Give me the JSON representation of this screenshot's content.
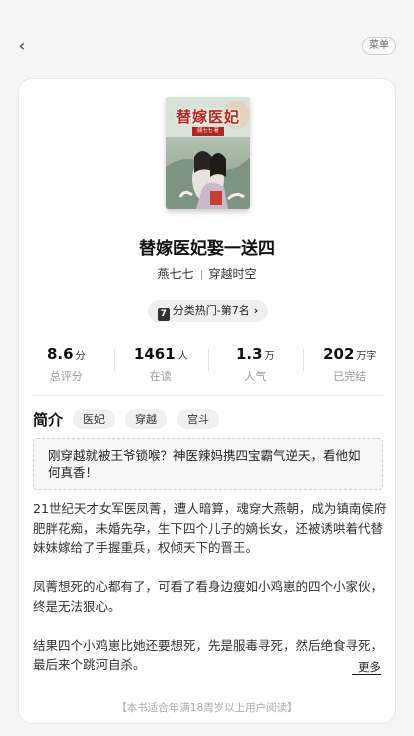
{
  "menu_label": "菜单",
  "cover": {
    "title_art": "替嫁医妃",
    "subtitle_art": "顾七七·著"
  },
  "book": {
    "title": "替嫁医妃娶一送四",
    "author": "燕七七",
    "category": "穿越时空"
  },
  "rank": {
    "badge": "7",
    "text": "分类热门-第7名"
  },
  "stats": [
    {
      "value": "8.6",
      "unit": "分",
      "label": "总评分"
    },
    {
      "value": "1461",
      "unit": "人",
      "label": "在读"
    },
    {
      "value": "1.3",
      "unit": "万",
      "label": "人气"
    },
    {
      "value": "202",
      "unit": "万字",
      "label": "已完结"
    }
  ],
  "intro": {
    "title": "简介",
    "tags": [
      "医妃",
      "穿越",
      "宫斗"
    ],
    "quote": "刚穿越就被王爷锁喉？神医辣妈携四宝霸气逆天，看他如何真香！",
    "paragraphs": [
      "21世纪天才女军医凤菁，遭人暗算，魂穿大燕朝，成为镇南侯府肥胖花痴，未婚先孕，生下四个儿子的嫡长女，还被诱哄着代替妹妹嫁给了手握重兵，权倾天下的晋王。",
      "凤菁想死的心都有了，可看了看身边瘦如小鸡崽的四个小家伙，终是无法狠心。",
      "结果四个小鸡崽比她还要想死，先是服毒寻死，然后绝食寻死，最后来个跳河自杀。"
    ],
    "more_label": "更多"
  },
  "footer_note": "【本书适合年满18周岁以上用户阅读】"
}
